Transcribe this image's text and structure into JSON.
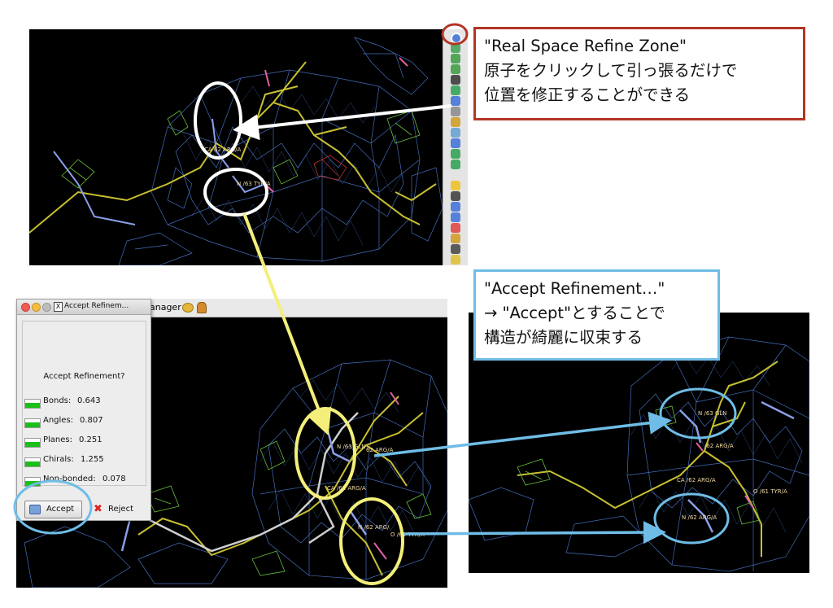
{
  "callouts": {
    "red": {
      "lines": [
        "\"Real Space Refine Zone\"",
        "原子をクリックして引っ張るだけで",
        "位置を修正することができる"
      ],
      "color": "#b33526"
    },
    "blue": {
      "lines": [
        "\"Accept Refinement…\"",
        "→ \"Accept\"とすることで",
        "構造が綺麗に収束する"
      ],
      "color": "#6fbde6"
    }
  },
  "toolbar": {
    "tools": [
      "real-space-refine-icon",
      "rotate-translate-icon",
      "rigid-body-icon",
      "regularize-icon",
      "pepflip-icon",
      "sidechain-icon",
      "rotamer-icon",
      "torsion-icon",
      "refine-icon",
      "chiral-icon",
      "blob-icon",
      "water-icon",
      "add-atom-icon",
      "radiation-icon",
      "mutate-icon",
      "auto-fit-icon",
      "add-terminal-icon",
      "delete-icon",
      "undo-icon",
      "trash-icon",
      "lightbulb-icon"
    ]
  },
  "dialog": {
    "title": "Accept Refinem...",
    "question": "Accept Refinement?",
    "stats": [
      {
        "label": "Bonds:",
        "value": "0.643"
      },
      {
        "label": "Angles:",
        "value": "0.807"
      },
      {
        "label": "Planes:",
        "value": "0.251"
      },
      {
        "label": "Chirals:",
        "value": "1.255"
      },
      {
        "label": "Non-bonded:",
        "value": "0.078"
      }
    ],
    "accept_label": "Accept",
    "reject_label": "Reject"
  },
  "menustrip": {
    "text": "anager"
  },
  "atom_labels": {
    "top": [
      "CA 62 ARG/A",
      "N /63 TYR/A"
    ],
    "bottom_left": [
      "N /63 GLN",
      "62 ARG/A",
      "CA /62 ARG/A",
      "N /62 ARG/",
      "O /61 TYR/A"
    ],
    "bottom_right": [
      "N /63 GLN",
      "/62 ARG/A",
      "CA /62 ARG/A",
      "O /61 TYR/A",
      "N /62 ARG/A"
    ]
  },
  "colors": {
    "mesh": "#4d79d0",
    "backbone": "#c8c030",
    "highlight_white": "#ffffff",
    "highlight_yellow": "#f3ef7a",
    "arrow_blue": "#6fbde6",
    "arrow_yellow": "#f3ef7a",
    "accept_ring": "#6fbde6"
  }
}
